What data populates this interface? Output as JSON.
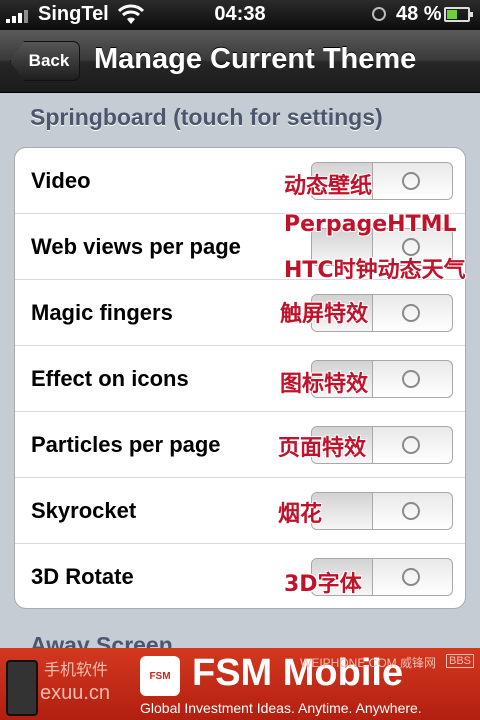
{
  "status_bar": {
    "carrier": "SingTel",
    "time": "04:38",
    "battery_percent": "48 %",
    "battery_level": 0.48
  },
  "nav": {
    "back_label": "Back",
    "title": "Manage Current Theme"
  },
  "section": {
    "header": "Springboard (touch for settings)",
    "rows": [
      {
        "label": "Video",
        "annotation": "动态壁纸",
        "enabled": false
      },
      {
        "label": "Web views per page",
        "annotation": "PerpageHTML",
        "annotation2": "HTC时钟动态天气",
        "enabled": false
      },
      {
        "label": "Magic fingers",
        "annotation": "触屏特效",
        "enabled": false
      },
      {
        "label": "Effect on icons",
        "annotation": "图标特效",
        "enabled": false
      },
      {
        "label": "Particles per page",
        "annotation": "页面特效",
        "enabled": false
      },
      {
        "label": "Skyrocket",
        "annotation": "烟花",
        "enabled": false
      },
      {
        "label": "3D Rotate",
        "annotation": "3D字体",
        "enabled": false
      }
    ]
  },
  "next_section": {
    "header": "Away Screen"
  },
  "banner": {
    "brand": "FSM Mobile",
    "logo_text": "FSM",
    "tagline": "Global Investment Ideas. Anytime. Anywhere.",
    "watermark_left_1": "手机软件",
    "watermark_left_2": "exuu.cn",
    "watermark_right": "WEIPHONE.COM 威锋网",
    "watermark_bbs": "BBS"
  },
  "colors": {
    "annotation": "#c0122a",
    "nav_bg": "#262626",
    "section_header": "#4c566c",
    "banner_bg": "#b21f10"
  }
}
